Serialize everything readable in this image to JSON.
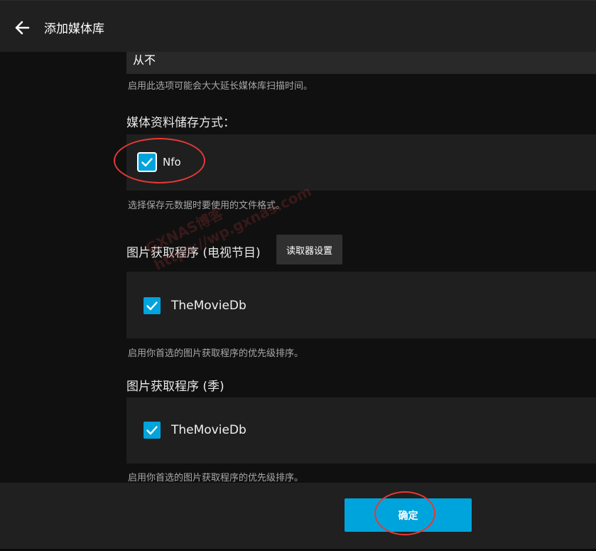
{
  "header": {
    "title": "添加媒体库"
  },
  "metadata_refresh": {
    "value": "从不",
    "help": "启用此选项可能会大大延长媒体库扫描时间。"
  },
  "metadata_savers": {
    "title": "媒体资料储存方式：",
    "options": [
      {
        "label": "Nfo",
        "checked": true
      }
    ],
    "help": "选择保存元数据时要使用的文件格式。"
  },
  "image_fetchers_series": {
    "title": "图片获取程序 (电视节目)",
    "settings_button": "读取器设置",
    "options": [
      {
        "label": "TheMovieDb",
        "checked": true
      }
    ],
    "help": "启用你首选的图片获取程序的优先级排序。"
  },
  "image_fetchers_season": {
    "title": "图片获取程序 (季)",
    "options": [
      {
        "label": "TheMovieDb",
        "checked": true
      }
    ],
    "help": "启用你首选的图片获取程序的优先级排序。"
  },
  "footer": {
    "confirm_label": "确定"
  },
  "watermark": {
    "line1": "GXNAS博客",
    "line2": "https://wp.gxnas.com"
  },
  "colors": {
    "accent": "#00a4dc",
    "annotation": "#e53935"
  }
}
